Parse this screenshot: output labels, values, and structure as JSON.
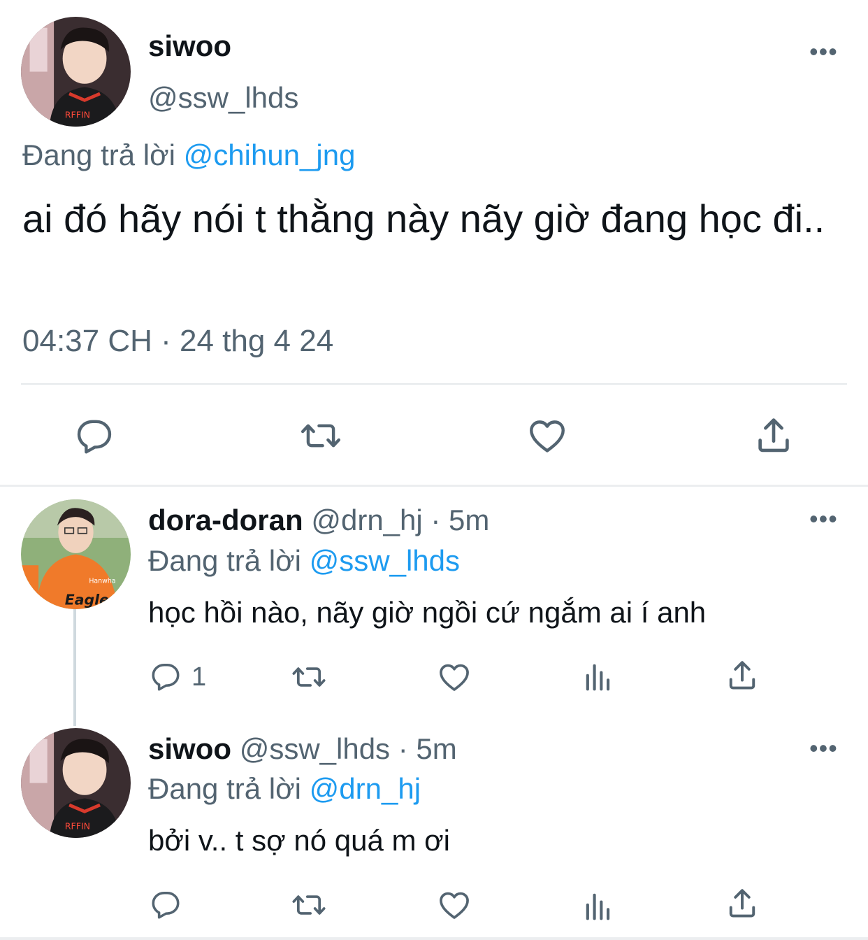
{
  "main_tweet": {
    "name": "siwoo",
    "handle": "@ssw_lhds",
    "replying_prefix": "Đang trả lời",
    "replying_to": "@chihun_jng",
    "text": "ai đó hãy nói t thằng này nãy giờ đang học đi..",
    "timestamp": "04:37 CH · 24 thg 4 24",
    "more": "•••",
    "avatar_icon": "user-avatar-siwoo",
    "actions": [
      "reply-icon",
      "retweet-icon",
      "like-icon",
      "share-icon"
    ]
  },
  "replies": [
    {
      "name": "dora-doran",
      "handle": "@drn_hj",
      "time": "· 5m",
      "replying_prefix": "Đang trả lời",
      "replying_to": "@ssw_lhds",
      "text": "học hồi nào, nãy giờ ngồi cứ ngắm ai í anh",
      "reply_count": "1",
      "more": "•••",
      "avatar_icon": "user-avatar-dora-doran",
      "actions": [
        "reply-icon",
        "retweet-icon",
        "like-icon",
        "analytics-icon",
        "share-icon"
      ]
    },
    {
      "name": "siwoo",
      "handle": "@ssw_lhds",
      "time": "· 5m",
      "replying_prefix": "Đang trả lời",
      "replying_to": "@drn_hj",
      "text": "bởi v.. t sợ nó quá m ơi",
      "more": "•••",
      "avatar_icon": "user-avatar-siwoo",
      "actions": [
        "reply-icon",
        "retweet-icon",
        "like-icon",
        "analytics-icon",
        "share-icon"
      ]
    }
  ],
  "colors": {
    "text": "#0f1419",
    "secondary": "#536471",
    "link": "#1d9bf0",
    "divider": "#e6e9ec"
  }
}
